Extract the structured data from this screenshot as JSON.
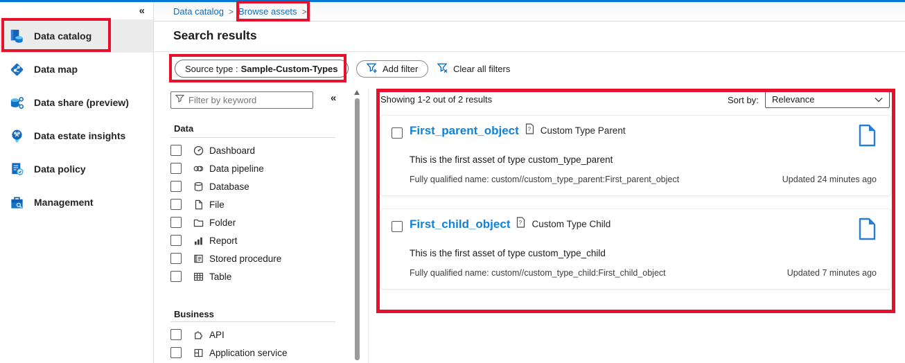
{
  "sidebar": {
    "collapse_icon": "«",
    "items": [
      {
        "label": "Data catalog",
        "active": true
      },
      {
        "label": "Data map",
        "active": false
      },
      {
        "label": "Data share (preview)",
        "active": false
      },
      {
        "label": "Data estate insights",
        "active": false
      },
      {
        "label": "Data policy",
        "active": false
      },
      {
        "label": "Management",
        "active": false
      }
    ]
  },
  "breadcrumb": {
    "item1": "Data catalog",
    "sep": ">",
    "item2": "Browse assets"
  },
  "page": {
    "title": "Search results"
  },
  "filter_bar": {
    "source_chip": {
      "label": "Source type :",
      "value": "Sample-Custom-Types"
    },
    "add_filter_label": "Add filter",
    "clear_all_label": "Clear all filters"
  },
  "filter_panel": {
    "keyword_placeholder": "Filter by keyword",
    "collapse_icon": "«",
    "sections": [
      {
        "title": "Data",
        "items": [
          "Dashboard",
          "Data pipeline",
          "Database",
          "File",
          "Folder",
          "Report",
          "Stored procedure",
          "Table"
        ]
      },
      {
        "title": "Business",
        "items": [
          "API",
          "Application service"
        ]
      }
    ]
  },
  "results": {
    "summary": "Showing 1-2 out of 2 results",
    "sort_label": "Sort by:",
    "sort_value": "Relevance",
    "cards": [
      {
        "title": "First_parent_object",
        "type": "Custom Type Parent",
        "description": "This is the first asset of type custom_type_parent",
        "fqn": "Fully qualified name: custom//custom_type_parent:First_parent_object",
        "updated": "Updated 24 minutes ago"
      },
      {
        "title": "First_child_object",
        "type": "Custom Type Child",
        "description": "This is the first asset of type custom_type_child",
        "fqn": "Fully qualified name: custom//custom_type_child:First_child_object",
        "updated": "Updated 7 minutes ago"
      }
    ]
  },
  "colors": {
    "accent": "#0078d4",
    "link_blue": "#0f6cbd",
    "title_blue": "#1182d6",
    "annotation_red": "#e8112d"
  }
}
